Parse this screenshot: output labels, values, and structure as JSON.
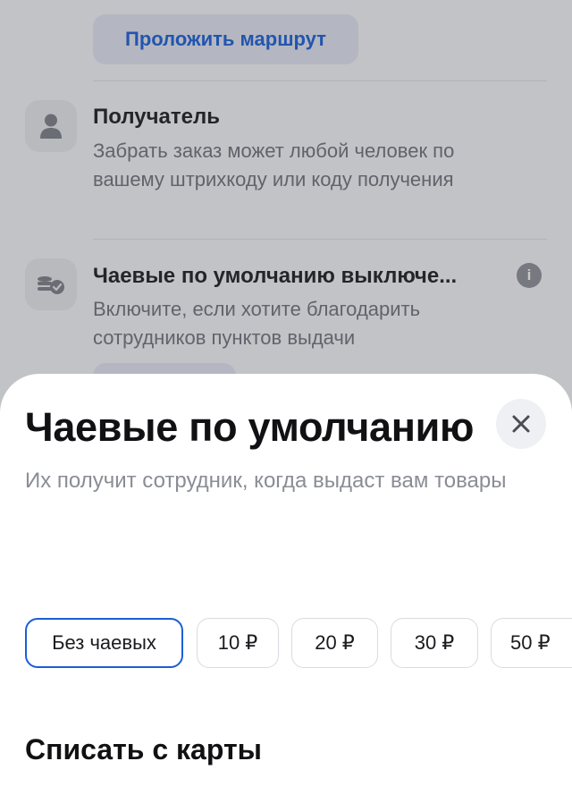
{
  "background": {
    "route_button": "Проложить маршрут",
    "recipient": {
      "title": "Получатель",
      "description": "Забрать заказ может любой человек по вашему штрихкоду или коду получения",
      "icon": "person-icon"
    },
    "tips": {
      "title": "Чаевые по умолчанию выключе...",
      "description": "Включите, если хотите благодарить сотрудников пунктов выдачи",
      "icon": "coins-check-icon",
      "info_icon": "info-icon",
      "info_glyph": "i"
    }
  },
  "sheet": {
    "title": "Чаевые по умолчанию",
    "subtitle": "Их получит сотрудник, когда выдаст вам товары",
    "close_icon": "close-icon",
    "tip_options": [
      {
        "label": "Без чаевых",
        "selected": true
      },
      {
        "label": "10 ₽",
        "selected": false
      },
      {
        "label": "20 ₽",
        "selected": false
      },
      {
        "label": "30 ₽",
        "selected": false
      },
      {
        "label": "50 ₽",
        "selected": false
      }
    ],
    "card_section_title": "Списать с карты"
  },
  "colors": {
    "accent": "#1a5fd6",
    "text_primary": "#111114",
    "text_secondary": "#8a8d94"
  }
}
